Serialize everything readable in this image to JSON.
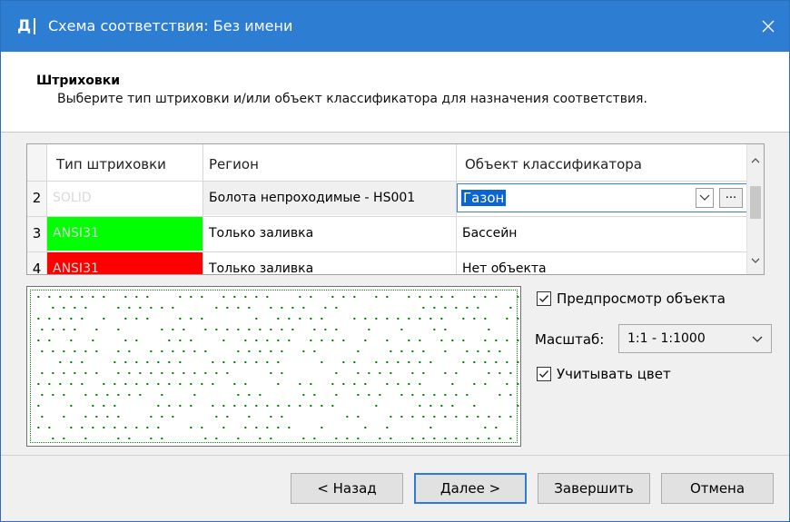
{
  "window": {
    "icon_letter": "Д",
    "title": "Схема соответствия: Без имени",
    "close_icon": "close-icon"
  },
  "header": {
    "title": "Штриховки",
    "subtitle": "Выберите тип штриховки и/или объект классификатора для назначения соответствия."
  },
  "grid": {
    "columns": [
      "Тип штриховки",
      "Регион",
      "Объект классификатора"
    ],
    "rows": [
      {
        "num": "2",
        "hatch": "SOLID",
        "hatch_color": "#ffffff",
        "region": "Болота непроходимые - HS001",
        "object": "Газон",
        "editing": true
      },
      {
        "num": "3",
        "hatch": "ANSI31",
        "hatch_color": "#00ff00",
        "region": "Только заливка",
        "object": "Бассейн"
      },
      {
        "num": "4",
        "hatch": "ANSI31",
        "hatch_color": "#ff0000",
        "region": "Только заливка",
        "object": "Нет объекта"
      }
    ]
  },
  "preview": {
    "dot_color": "#008000"
  },
  "options": {
    "preview_object": {
      "label": "Предпросмотр объекта",
      "checked": true
    },
    "scale": {
      "label": "Масштаб:",
      "value": "1:1 - 1:1000"
    },
    "use_color": {
      "label": "Учитывать цвет",
      "checked": true
    }
  },
  "buttons": {
    "back": "< Назад",
    "next": "Далее >",
    "finish": "Завершить",
    "cancel": "Отмена"
  }
}
